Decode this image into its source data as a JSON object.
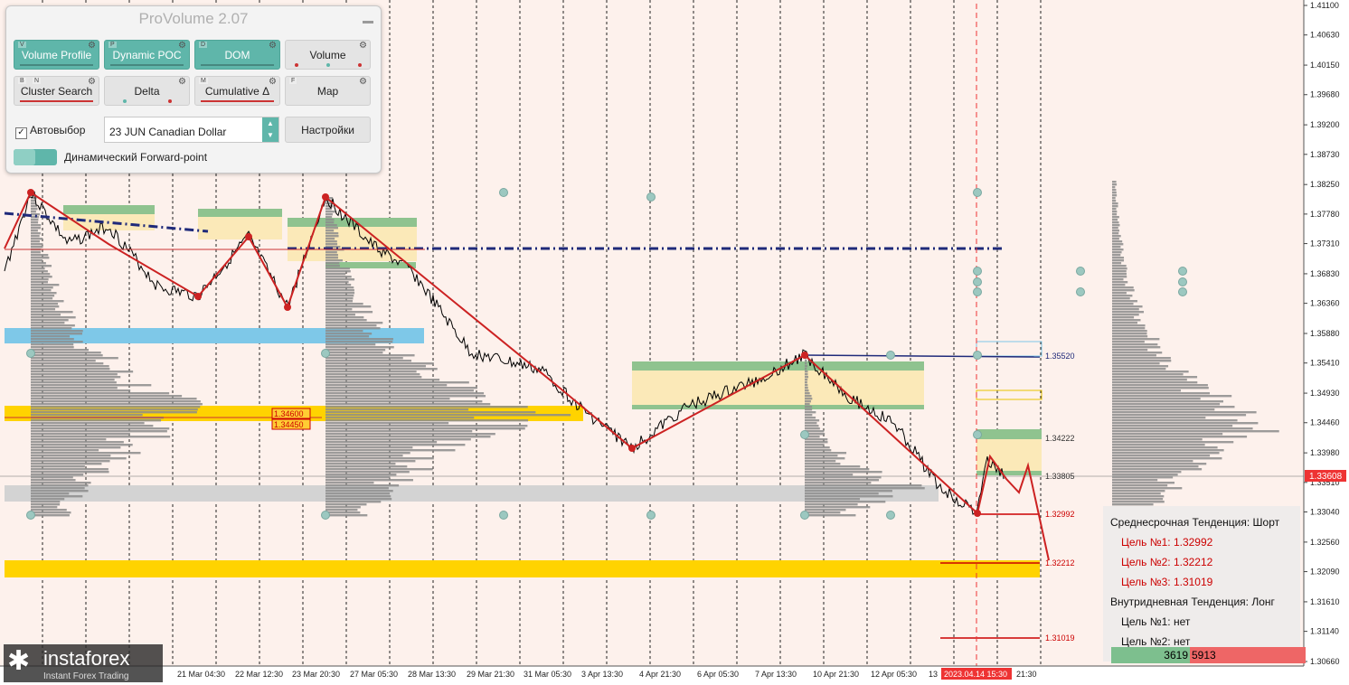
{
  "panel": {
    "title": "ProVolume 2.07",
    "row1": [
      {
        "key": "V",
        "label": "Volume Profile",
        "active": true
      },
      {
        "key": "P",
        "label": "Dynamic POC",
        "active": true
      },
      {
        "key": "D",
        "label": "DOM",
        "active": true
      },
      {
        "key": "",
        "label": "Volume",
        "active": false
      }
    ],
    "row2": [
      {
        "key": "B",
        "key2": "N",
        "label": "Cluster Search",
        "active": false
      },
      {
        "key": "",
        "label": "Delta",
        "active": false
      },
      {
        "key": "M",
        "label": "Cumulative Δ",
        "active": false
      },
      {
        "key": "F",
        "label": "Map",
        "active": false
      }
    ],
    "autoselect_label": "Автовыбор",
    "autoselect_checked": true,
    "instrument_value": "23 JUN Canadian Dollar",
    "settings_label": "Настройки",
    "forward_label": "Динамический Forward-point"
  },
  "price_axis": {
    "ticks": [
      "1.41100",
      "1.40630",
      "1.40150",
      "1.39680",
      "1.39200",
      "1.38730",
      "1.38250",
      "1.37780",
      "1.37310",
      "1.36830",
      "1.36360",
      "1.35880",
      "1.35410",
      "1.34930",
      "1.34460",
      "1.33980",
      "1.33510",
      "1.33040",
      "1.32560",
      "1.32090",
      "1.31610",
      "1.31140",
      "1.30660"
    ],
    "current_price": "1.33608",
    "current_color": "#ee3333"
  },
  "time_axis": {
    "labels": [
      "21 Mar 04:30",
      "22 Mar 12:30",
      "23 Mar 20:30",
      "27 Mar 05:30",
      "28 Mar 13:30",
      "29 Mar 21:30",
      "31 Mar 05:30",
      "3 Apr 13:30",
      "4 Apr 21:30",
      "6 Apr 05:30",
      "7 Apr 13:30",
      "10 Apr 21:30",
      "12 Apr 05:30",
      "13",
      "21:30"
    ],
    "cursor_label": "2023.04.14 15:30"
  },
  "zone_labels": {
    "upper": "1.34600",
    "lower": "1.34450"
  },
  "level_labels": [
    "1.35520",
    "1.34222",
    "1.33805",
    "1.32992",
    "1.32212",
    "1.31019"
  ],
  "info": {
    "mid_trend": "Среднесрочная Тенденция: Шорт",
    "mid_targets": [
      "Цель №1: 1.32992",
      "Цель №2: 1.32212",
      "Цель №3: 1.31019"
    ],
    "intraday_trend": "Внутридневная Тенденция: Лонг",
    "intraday_targets": [
      "Цель №1: нет",
      "Цель №2: нет"
    ],
    "buy_volume": "3619",
    "sell_volume": "5913",
    "target_color": "#cc0000"
  },
  "logo": {
    "name": "instaforex",
    "tagline": "Instant Forex Trading"
  }
}
